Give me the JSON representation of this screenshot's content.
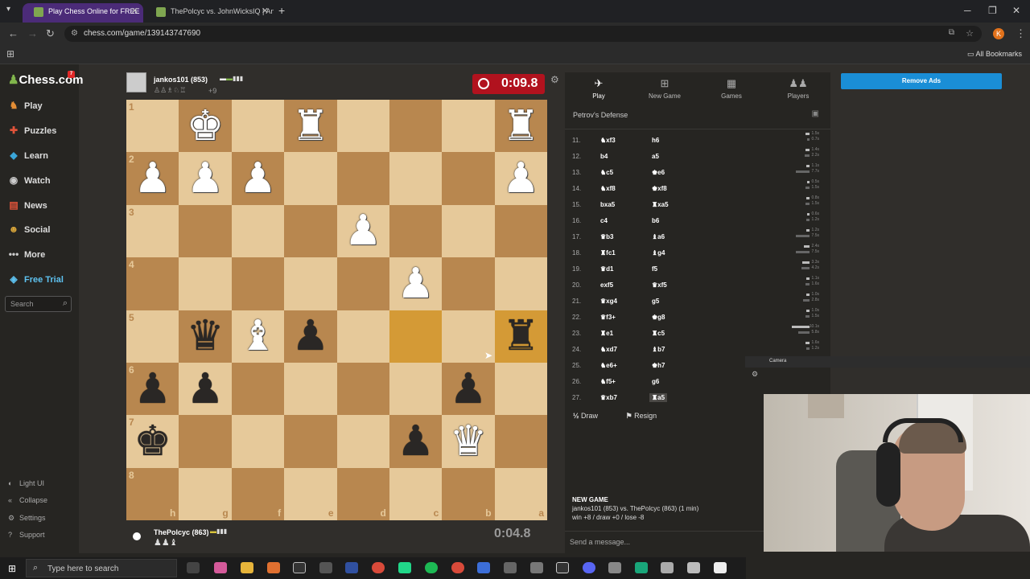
{
  "browser": {
    "tabs": [
      {
        "title": "Play Chess Online for FREE"
      },
      {
        "title": "ThePolcyc vs. JohnWicksIQ | An"
      }
    ],
    "url": "chess.com/game/139143747690",
    "bookmarks_label": "All Bookmarks",
    "profile_letter": "K"
  },
  "sidebar": {
    "logo": "Chess.com",
    "logo_badge": "7",
    "items": [
      {
        "label": "Play",
        "icon": "play-icon"
      },
      {
        "label": "Puzzles",
        "icon": "puzzle-icon"
      },
      {
        "label": "Learn",
        "icon": "learn-icon"
      },
      {
        "label": "Watch",
        "icon": "watch-icon"
      },
      {
        "label": "News",
        "icon": "news-icon"
      },
      {
        "label": "Social",
        "icon": "social-icon"
      },
      {
        "label": "More",
        "icon": "more-icon"
      },
      {
        "label": "Free Trial",
        "icon": "diamond-icon"
      }
    ],
    "search_placeholder": "Search",
    "bottom": [
      "Light UI",
      "Collapse",
      "Settings",
      "Support"
    ]
  },
  "top_player": {
    "name": "jankos101 (853)",
    "material": "+9",
    "clock": "0:09.8"
  },
  "bottom_player": {
    "name": "ThePolcyc (863)",
    "clock": "0:04.8"
  },
  "board": {
    "orientation": "black",
    "rank_labels": [
      "1",
      "2",
      "3",
      "4",
      "5",
      "6",
      "7",
      "8"
    ],
    "file_labels": [
      "h",
      "g",
      "f",
      "e",
      "d",
      "c",
      "b",
      "a"
    ],
    "highlight_squares": [
      "c5",
      "a5"
    ],
    "pieces": [
      {
        "sq": "g1",
        "p": "wK"
      },
      {
        "sq": "e1",
        "p": "wR"
      },
      {
        "sq": "a1",
        "p": "wR"
      },
      {
        "sq": "h2",
        "p": "wP"
      },
      {
        "sq": "g2",
        "p": "wP"
      },
      {
        "sq": "f2",
        "p": "wP"
      },
      {
        "sq": "a2",
        "p": "wP"
      },
      {
        "sq": "d3",
        "p": "wP"
      },
      {
        "sq": "c4",
        "p": "wP"
      },
      {
        "sq": "g5",
        "p": "bQ"
      },
      {
        "sq": "f5",
        "p": "wB"
      },
      {
        "sq": "e5",
        "p": "bP"
      },
      {
        "sq": "a5",
        "p": "bR"
      },
      {
        "sq": "h6",
        "p": "bP"
      },
      {
        "sq": "g6",
        "p": "bP"
      },
      {
        "sq": "b6",
        "p": "bP"
      },
      {
        "sq": "h7",
        "p": "bK"
      },
      {
        "sq": "c7",
        "p": "bP"
      },
      {
        "sq": "b7",
        "p": "wQ"
      }
    ]
  },
  "panel": {
    "tabs": [
      {
        "label": "Play",
        "icon": "pawn-icon"
      },
      {
        "label": "New Game",
        "icon": "plus-icon"
      },
      {
        "label": "Games",
        "icon": "board-icon"
      },
      {
        "label": "Players",
        "icon": "players-icon"
      }
    ],
    "opening": "Petrov's Defense",
    "moves": [
      {
        "n": "11.",
        "w": "♞xf3",
        "b": "h6"
      },
      {
        "n": "12.",
        "w": "b4",
        "b": "a5"
      },
      {
        "n": "13.",
        "w": "♞c5",
        "b": "♚e6"
      },
      {
        "n": "14.",
        "w": "♞xf8",
        "b": "♚xf8"
      },
      {
        "n": "15.",
        "w": "bxa5",
        "b": "♜xa5"
      },
      {
        "n": "16.",
        "w": "c4",
        "b": "b6"
      },
      {
        "n": "17.",
        "w": "♛b3",
        "b": "♝a6"
      },
      {
        "n": "18.",
        "w": "♜fc1",
        "b": "♝g4"
      },
      {
        "n": "19.",
        "w": "♛d1",
        "b": "f5"
      },
      {
        "n": "20.",
        "w": "exf5",
        "b": "♛xf5"
      },
      {
        "n": "21.",
        "w": "♛xg4",
        "b": "g5"
      },
      {
        "n": "22.",
        "w": "♛f3+",
        "b": "♚g8"
      },
      {
        "n": "23.",
        "w": "♜e1",
        "b": "♜c5"
      },
      {
        "n": "24.",
        "w": "♞xd7",
        "b": "♝b7"
      },
      {
        "n": "25.",
        "w": "♞e6+",
        "b": "♚h7"
      },
      {
        "n": "26.",
        "w": "♞f5+",
        "b": "g6"
      },
      {
        "n": "27.",
        "w": "♛xb7",
        "b": "♜a5"
      }
    ],
    "time_labels": [
      [
        "1.5s",
        "0.7s"
      ],
      [
        "1.4s",
        "2.2s"
      ],
      [
        "1.1s",
        "7.7s"
      ],
      [
        "0.5s",
        "1.5s"
      ],
      [
        "0.8s",
        "1.5s"
      ],
      [
        "0.6s",
        "1.2s"
      ],
      [
        "1.2s",
        "7.5s"
      ],
      [
        "2.4s",
        "7.5s"
      ],
      [
        "3.3s",
        "4.2s"
      ],
      [
        "1.1s",
        "1.6s"
      ],
      [
        "1.0s",
        "2.8s"
      ],
      [
        "1.0s",
        "1.5s"
      ],
      [
        "10.1s",
        "5.8s"
      ],
      [
        "1.6s",
        "1.2s"
      ]
    ],
    "draw_label": "Draw",
    "resign_label": "Resign",
    "new_game_title": "NEW GAME",
    "new_game_line": "jankos101 (853) vs. ThePolcyc (863) (1 min)",
    "new_game_stats": "win +8 / draw +0 / lose -8",
    "message_placeholder": "Send a message..."
  },
  "ads": {
    "remove_label": "Remove Ads"
  },
  "camera": {
    "title": "Camera"
  },
  "taskbar": {
    "search_placeholder": "Type here to search"
  }
}
